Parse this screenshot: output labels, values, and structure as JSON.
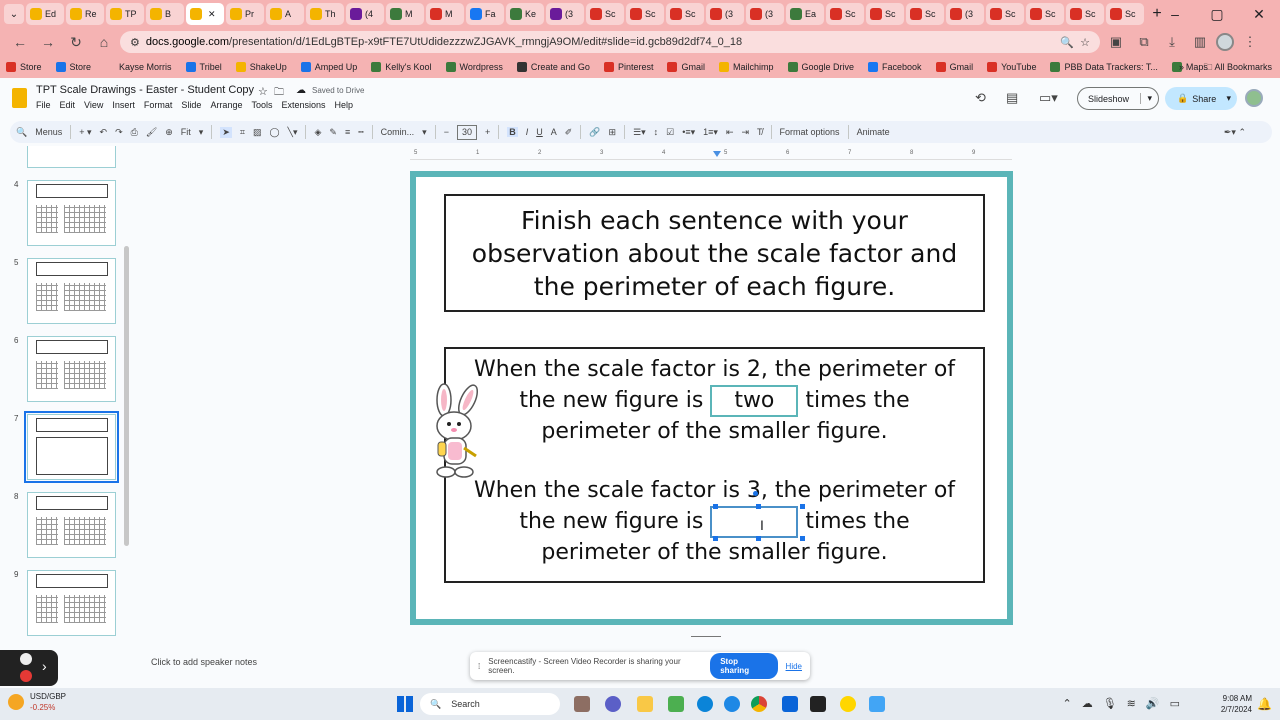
{
  "browser": {
    "tabs": [
      {
        "label": "Ed",
        "color": "#f4b400"
      },
      {
        "label": "Re",
        "color": "#f4b400"
      },
      {
        "label": "TP",
        "color": "#f4b400"
      },
      {
        "label": "B",
        "color": "#f4b400"
      },
      {
        "label": "",
        "color": "#f4b400",
        "active": true
      },
      {
        "label": "Pr",
        "color": "#f4b400"
      },
      {
        "label": "A",
        "color": "#f4b400"
      },
      {
        "label": "Th",
        "color": "#f4b400"
      },
      {
        "label": "(4",
        "color": "#6a1b9a"
      },
      {
        "label": "M",
        "color": "#3c7a3c"
      },
      {
        "label": "M",
        "color": "#d93025"
      },
      {
        "label": "Fa",
        "color": "#1877f2"
      },
      {
        "label": "Ke",
        "color": "#3c7a3c"
      },
      {
        "label": "(3",
        "color": "#6a1b9a"
      },
      {
        "label": "Sc",
        "color": "#d93025"
      },
      {
        "label": "Sc",
        "color": "#d93025"
      },
      {
        "label": "Sc",
        "color": "#d93025"
      },
      {
        "label": "(3",
        "color": "#d93025"
      },
      {
        "label": "(3",
        "color": "#d93025"
      },
      {
        "label": "Ea",
        "color": "#3c7a3c"
      },
      {
        "label": "Sc",
        "color": "#d93025"
      },
      {
        "label": "Sc",
        "color": "#d93025"
      },
      {
        "label": "Sc",
        "color": "#d93025"
      },
      {
        "label": "(3",
        "color": "#d93025"
      },
      {
        "label": "Sc",
        "color": "#d93025"
      },
      {
        "label": "Sc",
        "color": "#d93025"
      },
      {
        "label": "Sc",
        "color": "#d93025"
      },
      {
        "label": "Sc",
        "color": "#d93025"
      }
    ],
    "url_host": "docs.google.com",
    "url_path": "/presentation/d/1EdLgBTEp-x9tFTE7UtUdidezzzwZJGAVK_rmngjA9OM/edit#slide=id.gcb89d2df74_0_18",
    "bookmarks": [
      {
        "label": "Store",
        "color": "#d93025"
      },
      {
        "label": "Store",
        "color": "#1a73e8"
      },
      {
        "label": "Kayse Morris",
        "color": "#f5b3b3"
      },
      {
        "label": "Tribel",
        "color": "#1a73e8"
      },
      {
        "label": "ShakeUp",
        "color": "#f4b400"
      },
      {
        "label": "Amped Up",
        "color": "#1a73e8"
      },
      {
        "label": "Kelly's Kool",
        "color": "#3c7a3c"
      },
      {
        "label": "Wordpress",
        "color": "#3c7a3c"
      },
      {
        "label": "Create and Go",
        "color": "#333"
      },
      {
        "label": "Pinterest",
        "color": "#d93025"
      },
      {
        "label": "Gmail",
        "color": "#d93025"
      },
      {
        "label": "Mailchimp",
        "color": "#f4b400"
      },
      {
        "label": "Google Drive",
        "color": "#3c7a3c"
      },
      {
        "label": "Facebook",
        "color": "#1877f2"
      },
      {
        "label": "Gmail",
        "color": "#d93025"
      },
      {
        "label": "YouTube",
        "color": "#d93025"
      },
      {
        "label": "PBB Data Trackers: T...",
        "color": "#3c7a3c"
      },
      {
        "label": "Maps",
        "color": "#3c7a3c"
      }
    ],
    "all_bookmarks": "All Bookmarks"
  },
  "app": {
    "title": "TPT Scale Drawings - Easter - Student Copy",
    "saved_status": "Saved to Drive",
    "menu": [
      "File",
      "Edit",
      "View",
      "Insert",
      "Format",
      "Slide",
      "Arrange",
      "Tools",
      "Extensions",
      "Help"
    ],
    "slideshow_label": "Slideshow",
    "share_label": "Share"
  },
  "toolbar": {
    "menus_label": "Menus",
    "zoom_label": "Fit",
    "font_name": "Comin...",
    "font_size": "30",
    "format_options": "Format options",
    "animate": "Animate"
  },
  "filmstrip": {
    "slides": [
      {
        "num": "4"
      },
      {
        "num": "5"
      },
      {
        "num": "6"
      },
      {
        "num": "7",
        "selected": true
      },
      {
        "num": "8"
      },
      {
        "num": "9"
      }
    ]
  },
  "slide": {
    "title": "Finish each sentence with your observation about the scale factor and the perimeter of each figure.",
    "sentence1_a": "When the scale factor is 2, the perimeter of",
    "sentence1_b": "the new figure is",
    "sentence1_answer": "two",
    "sentence1_c": "times the",
    "sentence1_d": "perimeter of the smaller figure.",
    "sentence2_a": "When the scale factor is 3, the perimeter of",
    "sentence2_b": "the new figure is",
    "sentence2_answer": "",
    "sentence2_c": "times the",
    "sentence2_d": "perimeter of the smaller figure.",
    "ruler_numbers": [
      "5",
      "1",
      "2",
      "3",
      "4",
      "5",
      "6",
      "7",
      "8",
      "9"
    ]
  },
  "notes": {
    "placeholder": "Click to add speaker notes"
  },
  "screen_share": {
    "message": "Screencastify - Screen Video Recorder is sharing your screen.",
    "stop_label": "Stop sharing",
    "hide_label": "Hide"
  },
  "taskbar": {
    "ticker_name": "USD/GBP",
    "ticker_change": "-0.25%",
    "search_label": "Search",
    "time": "9:08 AM",
    "date": "2/7/2024"
  }
}
